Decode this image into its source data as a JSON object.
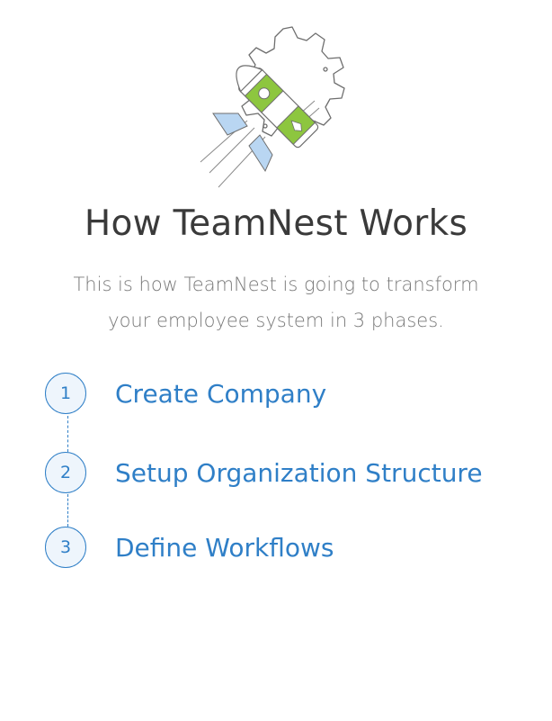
{
  "hero": {
    "icon": "rocket-gear-icon",
    "colors": {
      "gear": "#6b6b6b",
      "rocket": "#8dc63f",
      "fins": "#b9d6f2"
    }
  },
  "header": {
    "title": "How TeamNest Works",
    "subtitle_line1": "This is how TeamNest is going to transform",
    "subtitle_line2": "your employee system in 3 phases."
  },
  "steps": [
    {
      "number": "1",
      "label": "Create Company"
    },
    {
      "number": "2",
      "label": "Setup Organization Structure"
    },
    {
      "number": "3",
      "label": "Define Workflows"
    }
  ],
  "colors": {
    "accent": "#2f7fc7",
    "title": "#3a3a3a",
    "subtitle": "#7a7a7a"
  }
}
